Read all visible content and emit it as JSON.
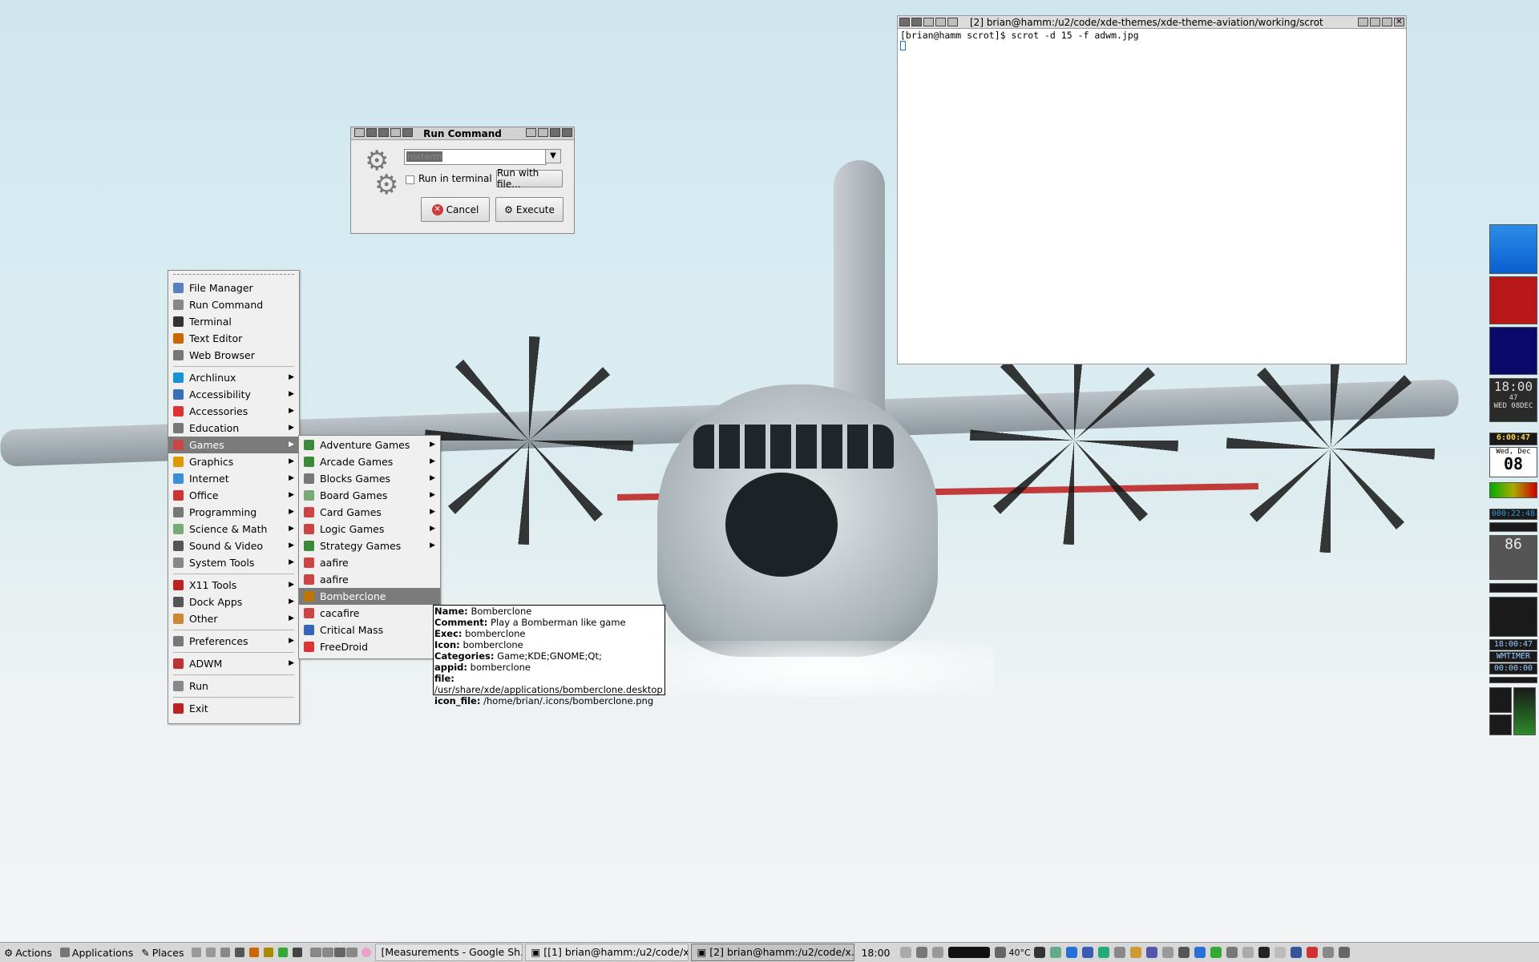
{
  "terminal": {
    "title": "[2] brian@hamm:/u2/code/xde-themes/xde-theme-aviation/working/scrot",
    "line1": "[brian@hamm scrot]$ scrot -d 15 -f adwm.jpg"
  },
  "run_dialog": {
    "title": "Run Command",
    "command_value": "roxterm",
    "run_in_terminal_label": "Run in terminal",
    "run_with_file_label": "Run with file...",
    "cancel_label": "Cancel",
    "execute_label": "Execute"
  },
  "main_menu": {
    "items": [
      {
        "label": "File Manager",
        "icon": "folder-icon"
      },
      {
        "label": "Run Command",
        "icon": "gear-icon"
      },
      {
        "label": "Terminal",
        "icon": "terminal-icon"
      },
      {
        "label": "Text Editor",
        "icon": "pencil-icon"
      },
      {
        "label": "Web Browser",
        "icon": "globe-icon"
      },
      {
        "label": "Archlinux",
        "icon": "arch-icon"
      },
      {
        "label": "Accessibility",
        "icon": "accessibility-icon"
      },
      {
        "label": "Accessories",
        "icon": "accessories-icon"
      },
      {
        "label": "Education",
        "icon": "education-icon"
      },
      {
        "label": "Games",
        "icon": "games-icon"
      },
      {
        "label": "Graphics",
        "icon": "graphics-icon"
      },
      {
        "label": "Internet",
        "icon": "globe-icon"
      },
      {
        "label": "Office",
        "icon": "office-icon"
      },
      {
        "label": "Programming",
        "icon": "programming-icon"
      },
      {
        "label": "Science & Math",
        "icon": "science-icon"
      },
      {
        "label": "Sound & Video",
        "icon": "sound-icon"
      },
      {
        "label": "System Tools",
        "icon": "system-icon"
      },
      {
        "label": "X11 Tools",
        "icon": "x11-icon"
      },
      {
        "label": "Dock Apps",
        "icon": "dock-icon"
      },
      {
        "label": "Other",
        "icon": "other-icon"
      },
      {
        "label": "Preferences",
        "icon": "preferences-icon"
      },
      {
        "label": "ADWM",
        "icon": "adwm-icon"
      },
      {
        "label": "Run",
        "icon": "gear-icon"
      },
      {
        "label": "Exit",
        "icon": "exit-icon"
      }
    ]
  },
  "games_menu": {
    "items": [
      {
        "label": "Adventure Games"
      },
      {
        "label": "Arcade Games"
      },
      {
        "label": "Blocks Games"
      },
      {
        "label": "Board Games"
      },
      {
        "label": "Card Games"
      },
      {
        "label": "Logic Games"
      },
      {
        "label": "Strategy Games"
      },
      {
        "label": "aafire"
      },
      {
        "label": "aafire"
      },
      {
        "label": "Bomberclone"
      },
      {
        "label": "cacafire"
      },
      {
        "label": "Critical Mass"
      },
      {
        "label": "FreeDroid"
      }
    ]
  },
  "tooltip": {
    "name_key": "Name:",
    "name_val": "Bomberclone",
    "comment_key": "Comment:",
    "comment_val": "Play a Bomberman like game",
    "exec_key": "Exec:",
    "exec_val": "bomberclone",
    "icon_key": "Icon:",
    "icon_val": "bomberclone",
    "categories_key": "Categories:",
    "categories_val": "Game;KDE;GNOME;Qt;",
    "appid_key": "appid:",
    "appid_val": "bomberclone",
    "file_key": "file:",
    "file_val": "/usr/share/xde/applications/bomberclone.desktop",
    "iconfile_key": "icon_file:",
    "iconfile_val": "/home/brian/.icons/bomberclone.png"
  },
  "dock": {
    "clock_time": "18:00",
    "clock_sec": "47",
    "clock_date": "WED 08DEC",
    "clock2": "6:00:47",
    "cal_day": "Wed, Dec",
    "cal_num": "08",
    "timer1": "000:22:48",
    "cpu": "86",
    "time3": "18:00:47",
    "wmtimer": "WMTIMER",
    "timer2": "00:00:00"
  },
  "taskbar": {
    "actions": "Actions",
    "applications": "Applications",
    "places": "Places",
    "tasks": [
      "[Measurements - Google Sh...",
      "[[1] brian@hamm:/u2/code/x...",
      "[2] brian@hamm:/u2/code/x..."
    ],
    "clock": "18:00",
    "temp": "40°C"
  },
  "colors": {
    "menu_highlight": "#7b7b7b",
    "taskbar_bg": "#d7d7d7"
  }
}
